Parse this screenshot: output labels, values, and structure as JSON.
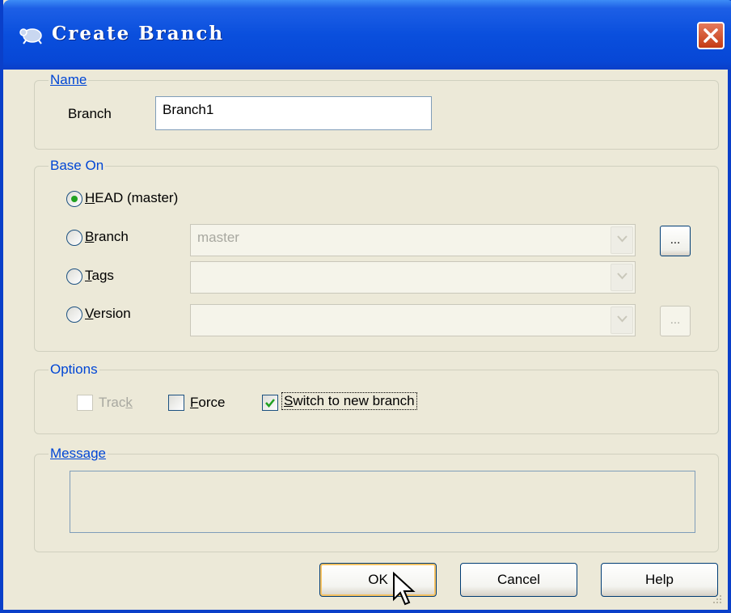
{
  "window": {
    "title": "Create Branch",
    "icon": "tortoisegit-icon",
    "close_icon": "close-icon"
  },
  "name_group": {
    "label": "Name",
    "branch_label": "Branch",
    "branch_value": "Branch1"
  },
  "base_on_group": {
    "label": "Base On",
    "head": {
      "label": "HEAD (master)",
      "checked": true
    },
    "branch": {
      "label": "Branch",
      "checked": false,
      "combo_value": "master",
      "browse_label": "..."
    },
    "tags": {
      "label": "Tags",
      "checked": false,
      "combo_value": ""
    },
    "version": {
      "label": "Version",
      "checked": false,
      "combo_value": "",
      "browse_label": "..."
    }
  },
  "options_group": {
    "label": "Options",
    "track": {
      "label": "Track",
      "checked": false,
      "enabled": false
    },
    "force": {
      "label": "Force",
      "checked": false
    },
    "switch": {
      "label": "Switch to new branch",
      "checked": true
    }
  },
  "message_group": {
    "label": "Message",
    "value": ""
  },
  "buttons": {
    "ok": "OK",
    "cancel": "Cancel",
    "help": "Help"
  },
  "colors": {
    "titlebar": "#0a4fdd",
    "group_label": "#0046d5",
    "dialog_bg": "#ece9d8"
  }
}
